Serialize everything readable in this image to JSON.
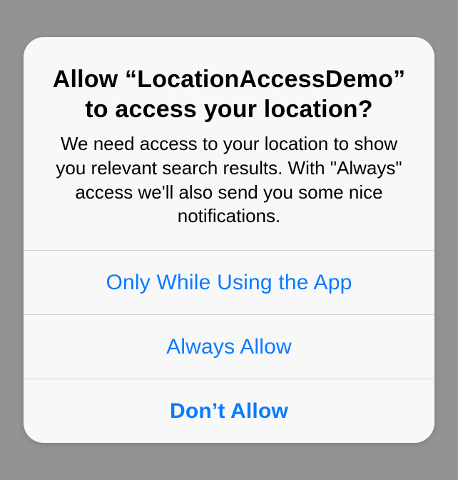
{
  "alert": {
    "title": "Allow “LocationAccessDemo” to access your location?",
    "message": "We need access to your location to show you relevant search results. With \"Always\" access we'll also send you some nice notifications.",
    "actions": {
      "only_while_using": "Only While Using the App",
      "always_allow": "Always Allow",
      "dont_allow": "Don’t Allow"
    }
  }
}
